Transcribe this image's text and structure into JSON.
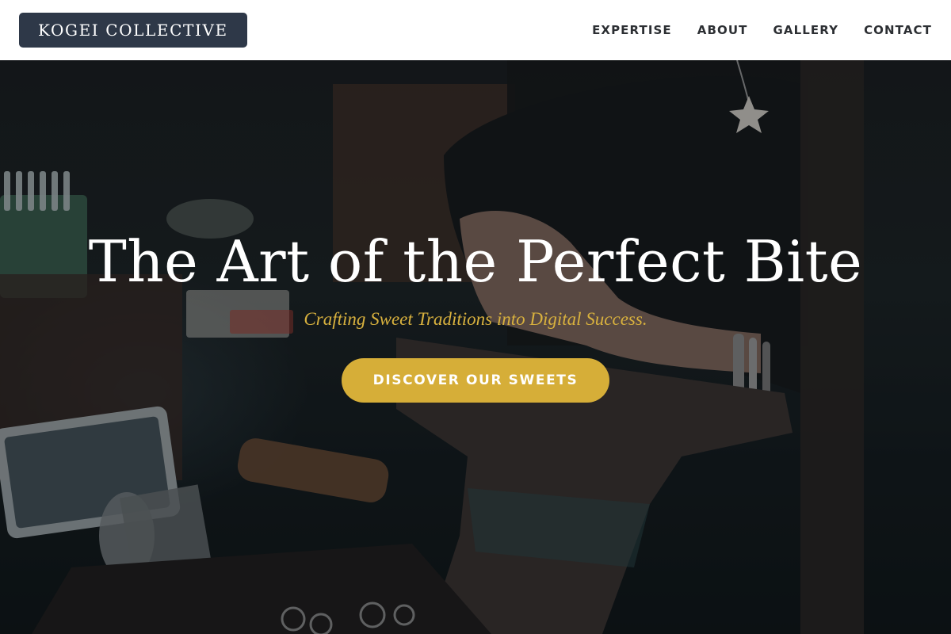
{
  "header": {
    "logo": "KOGEI COLLECTIVE",
    "nav": [
      {
        "label": "EXPERTISE"
      },
      {
        "label": "ABOUT"
      },
      {
        "label": "GALLERY"
      },
      {
        "label": "CONTACT"
      }
    ]
  },
  "hero": {
    "title": "The Art of the Perfect Bite",
    "subtitle": "Crafting Sweet Traditions into Digital Success.",
    "cta": "DISCOVER OUR SWEETS",
    "background_image": "artisan workshop: hands shaping metal on an anvil with tools",
    "colors": {
      "accent": "#d6ae38",
      "logo_bg": "#2e3848",
      "title": "#ffffff"
    }
  }
}
